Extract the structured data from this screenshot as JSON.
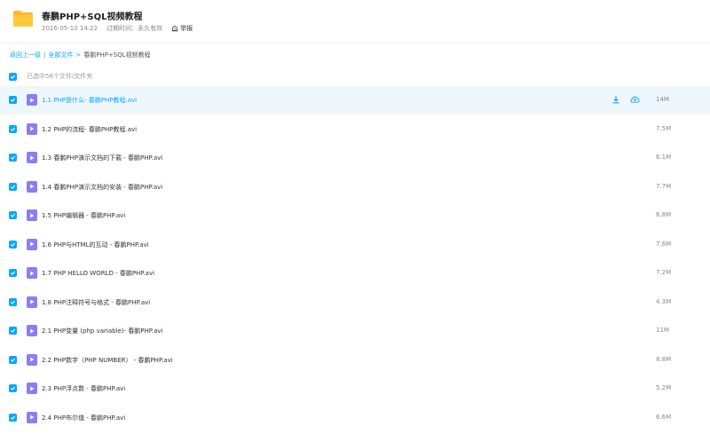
{
  "header": {
    "title": "春鹏PHP+SQL视频教程",
    "date": "2026-05-10 14:22",
    "expire_label": "过期时间：永久有效",
    "report_label": "举报"
  },
  "breadcrumb": {
    "back": "返回上一级",
    "all_files": "全部文件",
    "current": "春鹏PHP+SQL视频教程"
  },
  "selection": {
    "text": "已选中56个文件/文件夹"
  },
  "files": [
    {
      "name": "1.1 PHP是什么- 春鹏PHP教程.avi",
      "size": "14M"
    },
    {
      "name": "1.2 PHP的流程- 春鹏PHP教程.avi",
      "size": "7.5M"
    },
    {
      "name": "1.3 春鹏PHP演示文档的下载 - 春鹏PHP.avi",
      "size": "6.1M"
    },
    {
      "name": "1.4 春鹏PHP演示文档的安装 - 春鹏PHP.avi",
      "size": "7.7M"
    },
    {
      "name": "1.5 PHP编辑器 - 春鹏PHP.avi",
      "size": "6.8M"
    },
    {
      "name": "1.6 PHP与HTML的互动 - 春鹏PHP.avi",
      "size": "7.6M"
    },
    {
      "name": "1.7 PHP HELLO WORLD - 春鹏PHP.avi",
      "size": "7.2M"
    },
    {
      "name": "1.8 PHP注释符号与格式 - 春鹏PHP.avi",
      "size": "4.3M"
    },
    {
      "name": "2.1 PHP变量 (php variable)- 春鹏PHP.avi",
      "size": "11M"
    },
    {
      "name": "2.2 PHP数字（PHP NUMBER） - 春鹏PHP.avi",
      "size": "8.8M"
    },
    {
      "name": "2.3 PHP浮点数 - 春鹏PHP.avi",
      "size": "5.2M"
    },
    {
      "name": "2.4 PHP布尔值 - 春鹏PHP.avi",
      "size": "6.6M"
    }
  ],
  "colors": {
    "accent": "#06a7ff",
    "video_icon": "#8a7df5",
    "folder": "#ffc93c"
  }
}
